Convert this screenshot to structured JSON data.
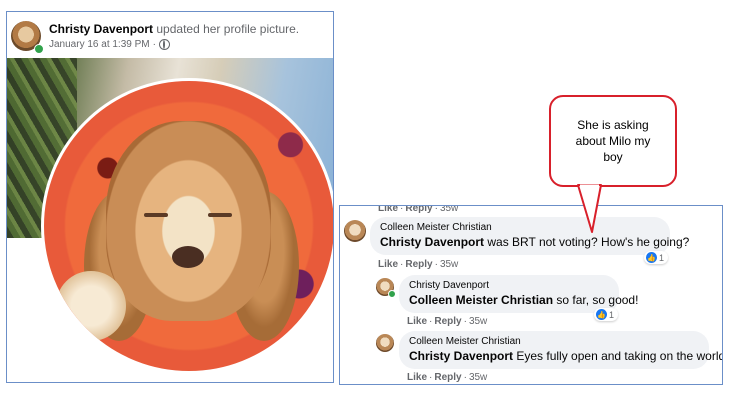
{
  "post": {
    "author": "Christy Davenport",
    "action": "updated her profile picture.",
    "date": "January 16 at 1:39 PM",
    "dot": "·",
    "privacy_icon": "globe-icon"
  },
  "comments": {
    "top_action": {
      "like": "Like",
      "reply": "Reply",
      "time": "35w"
    },
    "items": [
      {
        "author": "Colleen Meister Christian",
        "tag": "Christy Davenport",
        "text": " was BRT not voting? How's he going?",
        "like": "Like",
        "reply": "Reply",
        "time": "35w",
        "reaction_count": "1"
      },
      {
        "author": "Christy Davenport",
        "tag": "Colleen Meister Christian",
        "text": " so far, so good!",
        "like": "Like",
        "reply": "Reply",
        "time": "35w",
        "reaction_count": "1"
      },
      {
        "author": "Colleen Meister Christian",
        "tag": "Christy Davenport",
        "text": " Eyes fully open and taking on the world?",
        "like": "Like",
        "reply": "Reply",
        "time": "35w"
      }
    ]
  },
  "callout": {
    "line1": "She  is asking",
    "line2": "about Milo my",
    "line3": "boy",
    "border_color": "#d8202b"
  },
  "colors": {
    "accent": "#1877f2",
    "online": "#31a24c",
    "frame": "#6b8fc8"
  }
}
